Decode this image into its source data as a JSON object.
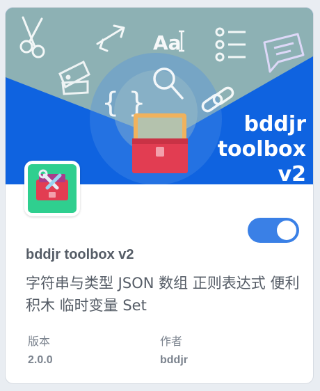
{
  "banner": {
    "title_lines": [
      "bddjr",
      "toolbox",
      "v2"
    ],
    "colors": {
      "blue": "#0f63e0",
      "teal_fan": "#8db1b4",
      "chest_red": "#e23d52",
      "chest_lid": "#f0b25d"
    },
    "icons": [
      "scissors-icon",
      "swap-arrows-icon",
      "font-size-icon",
      "list-icon",
      "chat-icon",
      "color-swatch-icon",
      "braces-icon",
      "magnifier-icon",
      "link-icon"
    ]
  },
  "extension": {
    "name": "bddjr toolbox v2",
    "description": "字符串与类型 JSON 数组 正则表达式 便利积木 临时变量 Set",
    "enabled": true,
    "version_label": "版本",
    "version_value": "2.0.0",
    "author_label": "作者",
    "author_value": "bddjr"
  }
}
